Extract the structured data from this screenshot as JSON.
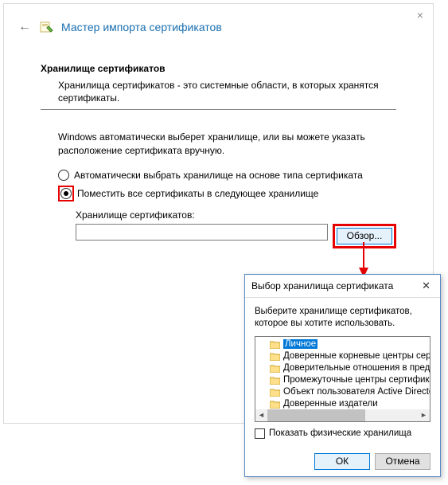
{
  "wizard": {
    "title": "Мастер импорта сертификатов",
    "section_title": "Хранилище сертификатов",
    "section_desc": "Хранилища сертификатов - это системные области, в которых хранятся сертификаты.",
    "auto_text": "Windows автоматически выберет хранилище, или вы можете указать расположение сертификата вручную.",
    "radio_auto": "Автоматически выбрать хранилище на основе типа сертификата",
    "radio_place": "Поместить все сертификаты в следующее хранилище",
    "store_label": "Хранилище сертификатов:",
    "browse": "Обзор..."
  },
  "dialog": {
    "title": "Выбор хранилища сертификата",
    "instruction": "Выберите хранилище сертификатов, которое вы хотите использовать.",
    "items": {
      "0": "Личное",
      "1": "Доверенные корневые центры сертифика",
      "2": "Доверительные отношения в предприяти",
      "3": "Промежуточные центры сертификации",
      "4": "Объект пользователя Active Directory",
      "5": "Доверенные издатели"
    },
    "show_physical": "Показать физические хранилища",
    "ok": "ОК",
    "cancel": "Отмена"
  }
}
